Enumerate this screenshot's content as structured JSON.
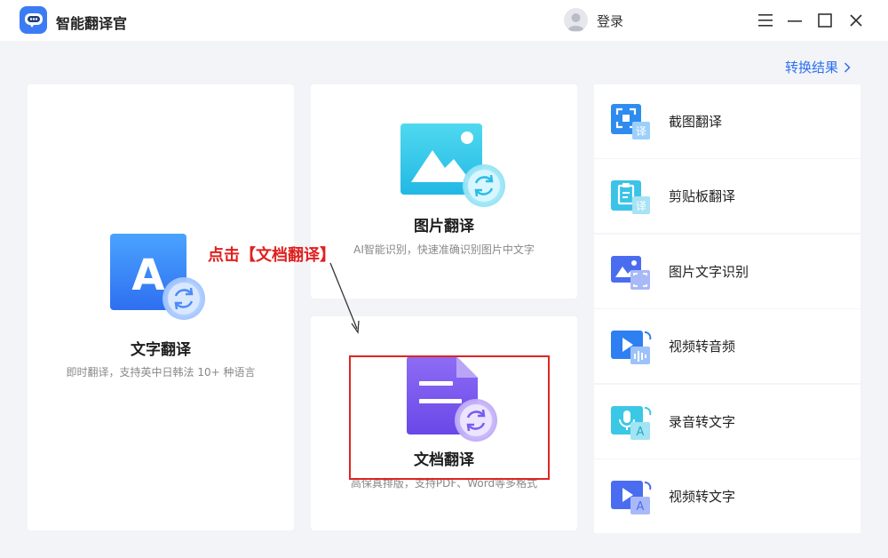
{
  "app": {
    "title": "智能翻译官",
    "login_label": "登录"
  },
  "header": {
    "result_link": "转换结果"
  },
  "cards": {
    "text_translate": {
      "title": "文字翻译",
      "desc": "即时翻译，支持英中日韩法 10+ 种语言",
      "icon_letter": "A"
    },
    "image_translate": {
      "title": "图片翻译",
      "desc": "AI智能识别，快速准确识别图片中文字"
    },
    "doc_translate": {
      "title": "文档翻译",
      "desc": "高保真排版，支持PDF、Word等多格式"
    }
  },
  "side_items": [
    {
      "label": "截图翻译",
      "icon": "screenshot-translate-icon",
      "badge": "译"
    },
    {
      "label": "剪贴板翻译",
      "icon": "clipboard-translate-icon",
      "badge": "译"
    },
    {
      "label": "图片文字识别",
      "icon": "image-ocr-icon",
      "badge": ""
    },
    {
      "label": "视频转音频",
      "icon": "video-to-audio-icon",
      "badge": ""
    },
    {
      "label": "录音转文字",
      "icon": "audio-to-text-icon",
      "badge": "A"
    },
    {
      "label": "视频转文字",
      "icon": "video-to-text-icon",
      "badge": "A"
    }
  ],
  "annotation": {
    "text": "点击【文档翻译】"
  },
  "colors": {
    "accent": "#2e6ff0",
    "annotation_red": "#e0201e"
  }
}
